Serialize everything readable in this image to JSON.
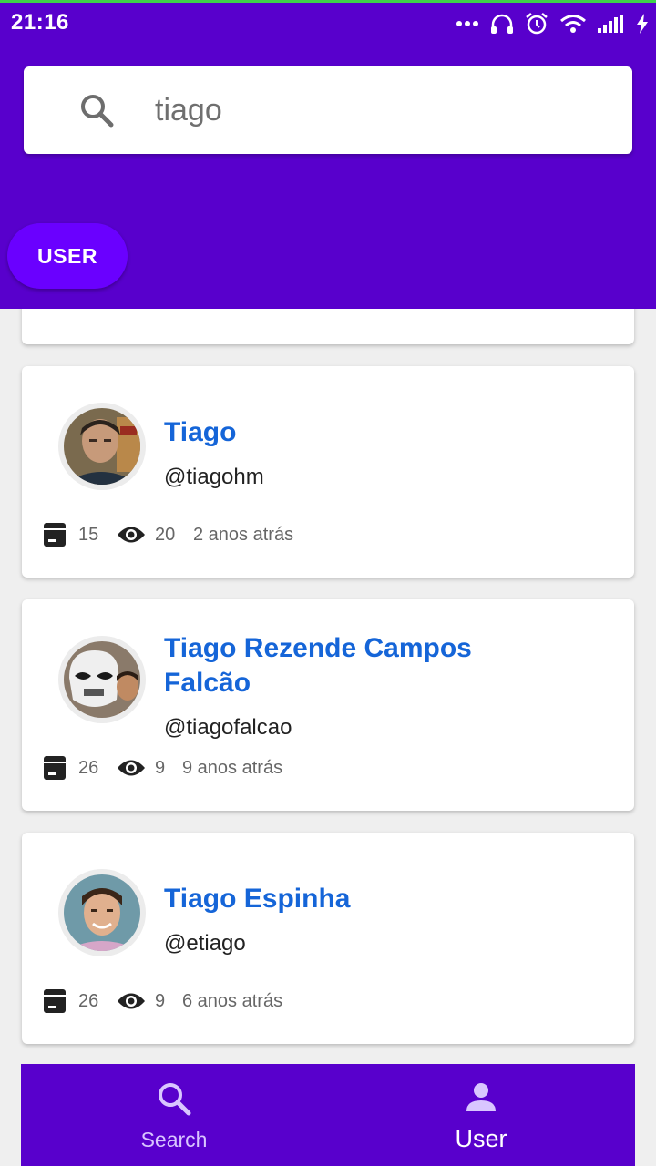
{
  "status_bar": {
    "time": "21:16",
    "icons": [
      "more-dots-icon",
      "headphones-icon",
      "alarm-icon",
      "wifi-icon",
      "signal-icon",
      "charging-icon"
    ]
  },
  "search": {
    "value": "tiago",
    "icon": "search-icon"
  },
  "filter_chip": {
    "label": "USER"
  },
  "users": [
    {
      "name": "Tiago",
      "handle": "@tiagohm",
      "repos": "15",
      "views": "20",
      "joined": "2 anos atrás",
      "avatar": "avatar-photo-man-dark-hair"
    },
    {
      "name": "Tiago Rezende Campos Falcão",
      "handle": "@tiagofalcao",
      "repos": "26",
      "views": "9",
      "joined": "9 anos atrás",
      "avatar": "avatar-photo-stormtrooper"
    },
    {
      "name": "Tiago Espinha",
      "handle": "@etiago",
      "repos": "26",
      "views": "9",
      "joined": "6 anos atrás",
      "avatar": "avatar-photo-man-smiling"
    }
  ],
  "bottom_nav": {
    "search_label": "Search",
    "user_label": "User",
    "active": "User"
  },
  "colors": {
    "primary": "#5800cc",
    "chip": "#6a00ff",
    "name_link": "#1565d8",
    "background": "#efefef"
  }
}
